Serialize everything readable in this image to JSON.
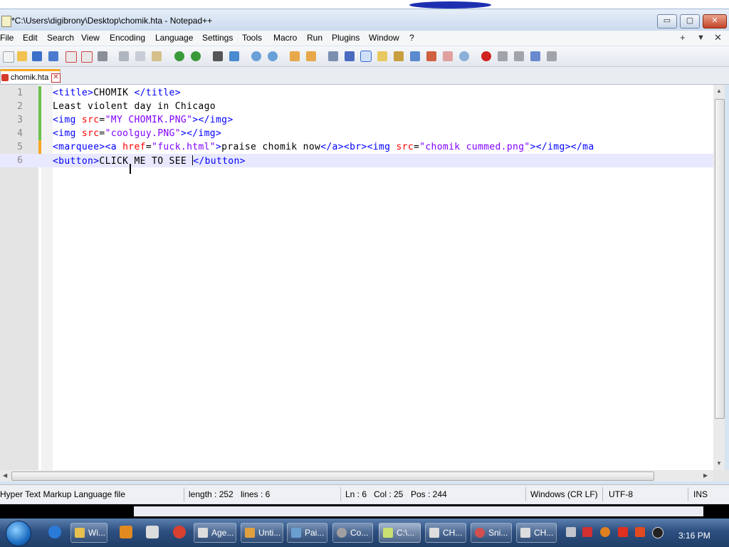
{
  "window": {
    "title": "*C:\\Users\\digibrony\\Desktop\\chomik.hta - Notepad++",
    "buttons": {
      "minimize": "▭",
      "maximize": "▢",
      "close": "✕"
    }
  },
  "menu": {
    "items": [
      "File",
      "Edit",
      "Search",
      "View",
      "Encoding",
      "Language",
      "Settings",
      "Tools",
      "Macro",
      "Run",
      "Plugins",
      "Window",
      "?"
    ],
    "right": {
      "plus": "+",
      "down": "▼",
      "close": "✕"
    }
  },
  "tab": {
    "label": "chomik.hta",
    "close": "✕"
  },
  "editor": {
    "line_numbers": [
      "1",
      "2",
      "3",
      "4",
      "5",
      "6"
    ],
    "lines": {
      "l1": {
        "tag1": "<title>",
        "text": "CHOMIK ",
        "tag2": "</title>"
      },
      "l2": {
        "text": "Least violent day in Chicago"
      },
      "l3": {
        "tag1": "<img ",
        "attr": "src",
        "eq": "=",
        "val": "\"MY CHOMIK.PNG\"",
        "tag2": "></img>"
      },
      "l4": {
        "tag1": "<img ",
        "attr": "src",
        "eq": "=",
        "val": "\"coolguy.PNG\"",
        "tag2": "></img>"
      },
      "l5": {
        "tag1": "<marquee><a ",
        "attr1": "href",
        "eq1": "=",
        "val1": "\"fuck.html\"",
        "tag2": ">",
        "text": "praise chomik now",
        "tag3": "</a><br><img ",
        "attr2": "src",
        "eq2": "=",
        "val2": "\"chomik cummed.png\"",
        "tag4": "></img></ma"
      },
      "l6": {
        "tag1": "<button>",
        "text": "CLICK ME TO SEE ",
        "tag2": "</button>"
      }
    }
  },
  "statusbar": {
    "filetype": "Hyper Text Markup Language file",
    "length": "length : 252",
    "lines": "lines : 6",
    "ln": "Ln : 6",
    "col": "Col : 25",
    "pos": "Pos : 244",
    "eol": "Windows (CR LF)",
    "encoding": "UTF-8",
    "mode": "INS"
  },
  "taskbar": {
    "buttons": [
      "Wi...",
      "Age...",
      "Unti...",
      "Pai...",
      "Co...",
      "C:\\...",
      "CH...",
      "Sni...",
      "CH..."
    ],
    "clock": "3:16 PM"
  },
  "colors": {
    "tag": "#0000ff",
    "attribute": "#ff0000",
    "value": "#8000ff",
    "current_line": "#e8e8ff",
    "change_bar": "#6cc04a",
    "unsaved_bar": "#f5a623"
  }
}
